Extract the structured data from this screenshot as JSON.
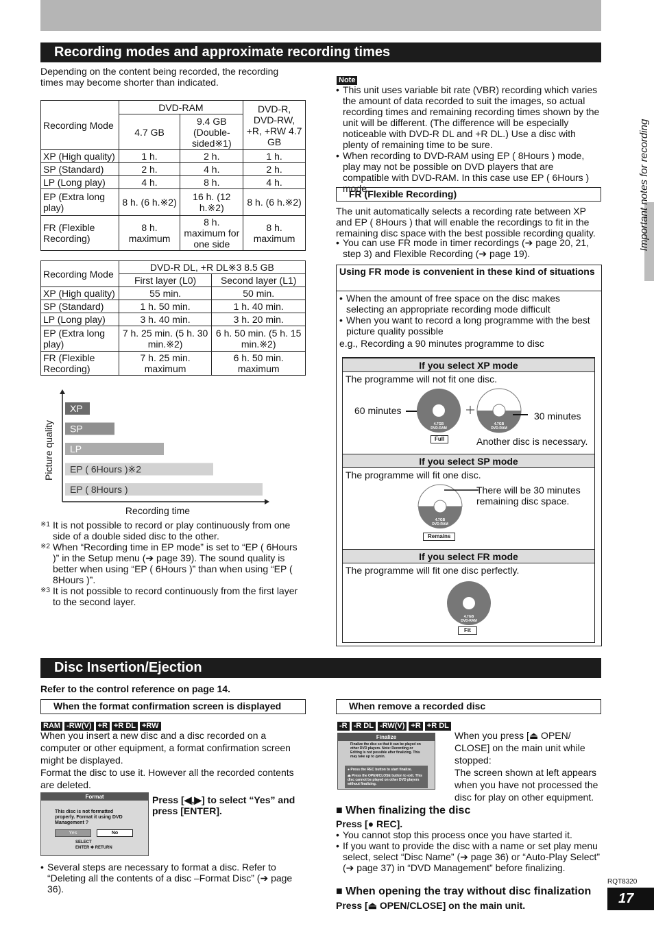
{
  "section1": {
    "title": "Recording modes and approximate recording times",
    "intro": "Depending on the content being recorded, the recording times may become shorter than indicated.",
    "table1": {
      "h_mode": "Recording Mode",
      "h_ram": "DVD-RAM",
      "h_47": "4.7 GB",
      "h_94": "9.4 GB (Double-sided※1)",
      "h_dvdr": "DVD-R, DVD-RW, +R, +RW 4.7 GB",
      "rows": [
        [
          "XP (High quality)",
          "1 h.",
          "2 h.",
          "1 h."
        ],
        [
          "SP (Standard)",
          "2 h.",
          "4 h.",
          "2 h."
        ],
        [
          "LP (Long play)",
          "4 h.",
          "8 h.",
          "4 h."
        ],
        [
          "EP (Extra long play)",
          "8 h. (6 h.※2)",
          "16 h. (12 h.※2)",
          "8 h. (6 h.※2)"
        ],
        [
          "FR (Flexible Recording)",
          "8 h. maximum",
          "8 h. maximum for one side",
          "8 h. maximum"
        ]
      ]
    },
    "table2": {
      "h_mode": "Recording Mode",
      "h_dl": "DVD-R DL, +R DL※3 8.5 GB",
      "h_l0": "First layer (L0)",
      "h_l1": "Second layer (L1)",
      "rows": [
        [
          "XP (High quality)",
          "55 min.",
          "50 min."
        ],
        [
          "SP (Standard)",
          "1 h. 50 min.",
          "1 h. 40 min."
        ],
        [
          "LP (Long play)",
          "3 h. 40 min.",
          "3 h. 20 min."
        ],
        [
          "EP (Extra long play)",
          "7 h. 25 min. (5 h. 30 min.※2)",
          "6 h. 50 min. (5 h. 15 min.※2)"
        ],
        [
          "FR (Flexible Recording)",
          "7 h. 25 min. maximum",
          "6 h. 50 min. maximum"
        ]
      ]
    },
    "footnotes": [
      {
        "mark": "※1",
        "text": "It is not possible to record or play continuously from one side of a double sided disc to the other."
      },
      {
        "mark": "※2",
        "text": "When “Recording time in EP mode” is set to “EP ( 6Hours )” in the Setup menu (➔ page 39). The sound quality is better when using “EP ( 6Hours )” than when using “EP ( 8Hours )”."
      },
      {
        "mark": "※3",
        "text": "It is not possible to record continuously from the first layer to the second layer."
      }
    ]
  },
  "chart_data": {
    "type": "bar",
    "orientation": "horizontal",
    "xlabel": "Recording time",
    "ylabel": "Picture quality",
    "categories": [
      "XP",
      "SP",
      "LP",
      "EP ( 6Hours )※2",
      "EP ( 8Hours )"
    ],
    "values": [
      1,
      2,
      4,
      6,
      8
    ],
    "colors": [
      "#6b6b6b",
      "#8f8f8f",
      "#ababab",
      "#d2d2d2",
      "#d2d2d2"
    ]
  },
  "note": {
    "label": "Note",
    "bullets": [
      "This unit uses variable bit rate (VBR) recording which varies the amount of data recorded to suit the images, so actual recording times and remaining recording times shown by the unit will be different. (The difference will be especially noticeable with DVD-R DL and +R DL.) Use a disc with plenty of remaining time to be sure.",
      "When recording to DVD-RAM using EP ( 8Hours ) mode, play may not be possible on DVD players that are compatible with DVD-RAM. In this case use EP ( 6Hours ) mode."
    ]
  },
  "fr": {
    "heading": "FR (Flexible Recording)",
    "para": "The unit automatically selects a recording rate between XP and EP ( 8Hours ) that will enable the recordings to fit in the remaining disc space with the best possible recording quality.",
    "bullet": "You can use FR mode in timer recordings (➔ page 20, 21, step 3) and Flexible Recording (➔ page 19).",
    "box": {
      "title": "Using FR mode is convenient in these kind of situations",
      "bullets": [
        "When the amount of free space on the disc makes selecting an appropriate recording mode difficult",
        "When you want to record a long programme with the best picture quality possible"
      ],
      "example": "e.g., Recording a 90 minutes programme to disc",
      "xp": {
        "title": "If you select XP mode",
        "text": "The programme will not fit one disc.",
        "left": "60 minutes",
        "right": "30 minutes",
        "full": "Full",
        "another": "Another disc is necessary."
      },
      "sp": {
        "title": "If you select SP mode",
        "text": "The programme will fit one disc.",
        "note": "There will be 30 minutes remaining disc space.",
        "remains": "Remains"
      },
      "frm": {
        "title": "If you select FR mode",
        "text": "The programme will fit one disc perfectly.",
        "fit": "Fit"
      },
      "disc_l1": "4.7GB",
      "disc_l2": "DVD-RAM"
    }
  },
  "side_tab": "Important notes for recording",
  "section2": {
    "title": "Disc Insertion/Ejection",
    "refer": "Refer to the control reference on page 14.",
    "left": {
      "heading": "When the format confirmation screen is displayed",
      "badges": [
        "RAM",
        "-RW(V)",
        "+R",
        "+R DL",
        "+RW"
      ],
      "text": "When you insert a new disc and a disc recorded on a computer or other equipment, a format confirmation screen might be displayed.",
      "text2": "Format the disc to use it. However all the recorded contents are deleted.",
      "screen": {
        "title": "Format",
        "msg": "This disc is not formatted properly. Format it using DVD Management ?",
        "yes": "Yes",
        "no": "No",
        "select": "SELECT",
        "enter": "ENTER",
        "ret": "RETURN"
      },
      "press": "Press [◀,▶] to select “Yes” and press [ENTER].",
      "bullet": "Several steps are necessary to format a disc. Refer to “Deleting all the contents of a disc –Format Disc” (➔ page 36)."
    },
    "right": {
      "heading": "When remove a recorded disc",
      "badges": [
        "-R",
        "-R DL",
        "-RW(V)",
        "+R",
        "+R DL"
      ],
      "screen": {
        "title": "Finalize",
        "msg": "Finalize the disc so that it can be played on other DVD players. Note: Recording or Editing is not possible after finalizing. This may take up to ◷min.",
        "rec": "Press the REC button to start finalize.",
        "open": "Press the OPEN/CLOSE button to exit. This disc cannot be played on other DVD players without finalizing."
      },
      "text": "When you press [⏏ OPEN/ CLOSE] on the main unit while stopped:",
      "text2": "The screen shown at left appears when you have not processed the disc for play on other equipment.",
      "fin_title": "When finalizing the disc",
      "fin_press": "Press [● REC].",
      "fin_bullets": [
        "You cannot stop this process once you have started it.",
        "If you want to provide the disc with a name or set play menu select, select “Disc Name” (➔ page 36) or “Auto-Play Select” (➔ page 37) in “DVD Management” before finalizing."
      ],
      "open_title": "When opening the tray without disc finalization",
      "open_press": "Press [⏏ OPEN/CLOSE] on the main unit."
    }
  },
  "footer": {
    "code": "RQT8320",
    "page": "17"
  }
}
